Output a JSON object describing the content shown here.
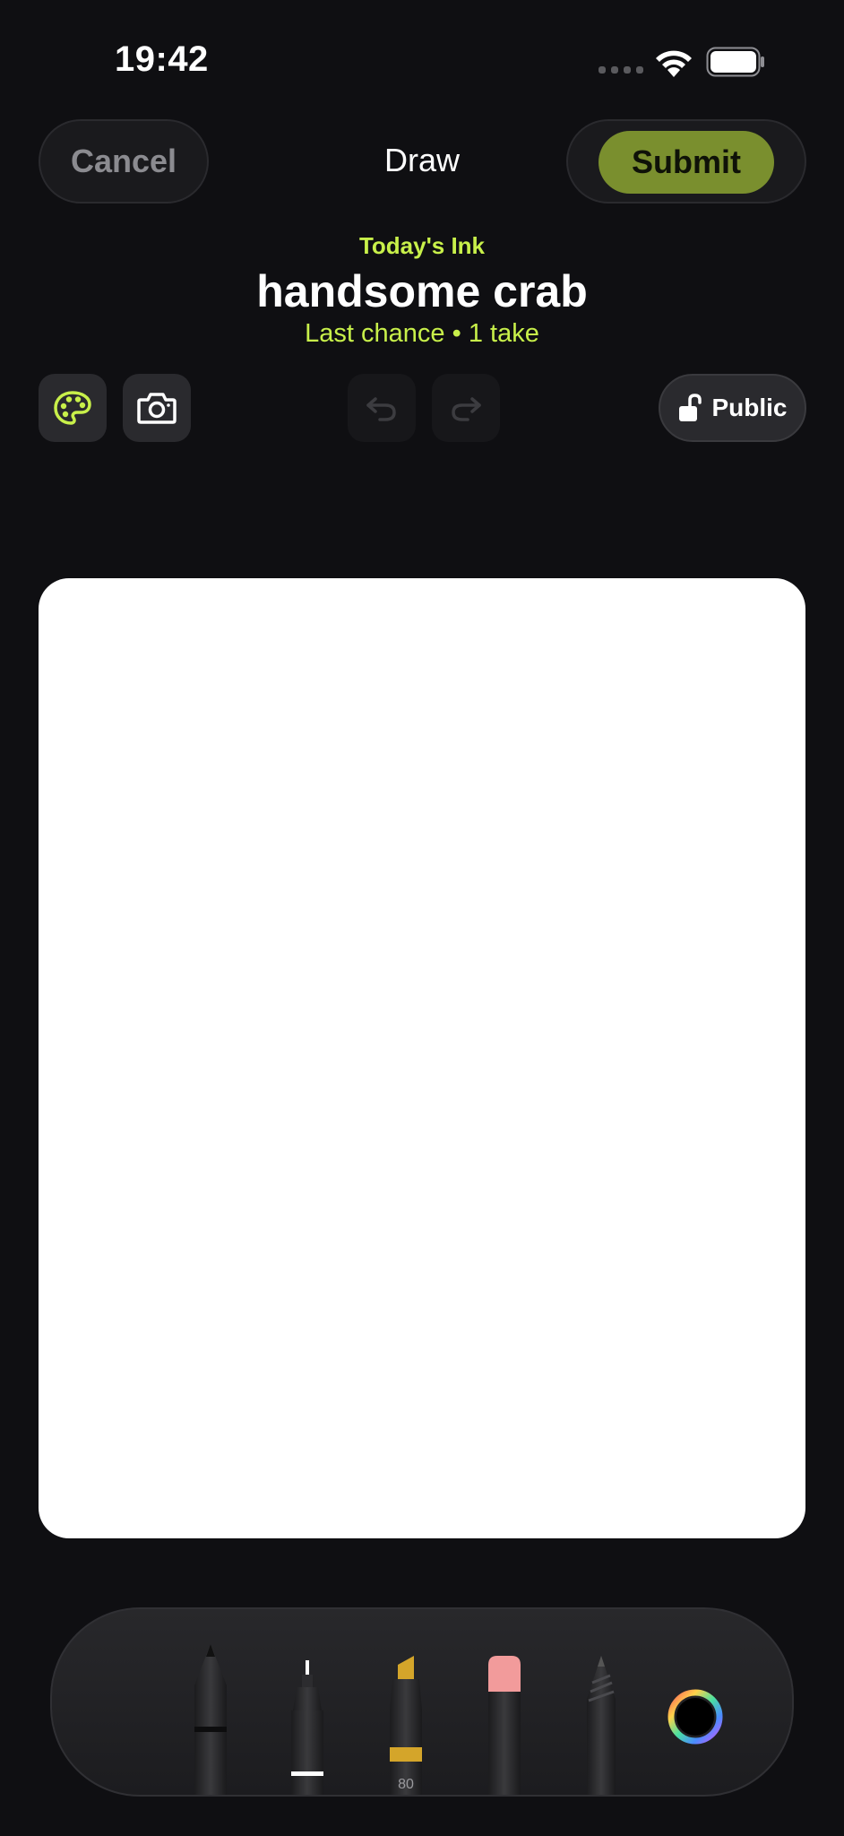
{
  "status_bar": {
    "time": "19:42"
  },
  "header": {
    "cancel_label": "Cancel",
    "title": "Draw",
    "submit_label": "Submit"
  },
  "prompt": {
    "eyebrow": "Today's Ink",
    "word": "handsome crab",
    "subline": "Last chance • 1 take"
  },
  "toolbar": {
    "palette_icon": "palette-icon",
    "camera_icon": "camera-icon",
    "undo_icon": "undo-icon",
    "redo_icon": "redo-icon",
    "visibility_label": "Public",
    "visibility_icon": "unlock-icon"
  },
  "tools": {
    "items": [
      {
        "name": "pen-tool"
      },
      {
        "name": "fineliner-tool"
      },
      {
        "name": "marker-tool",
        "label": "80"
      },
      {
        "name": "eraser-tool"
      },
      {
        "name": "pencil-tool"
      },
      {
        "name": "color-picker"
      }
    ]
  },
  "colors": {
    "accent": "#c8f04a",
    "submit_bg": "#7a8f2e",
    "background": "#0f0f12",
    "marker": "#d4a52a",
    "eraser": "#f29b9b"
  }
}
